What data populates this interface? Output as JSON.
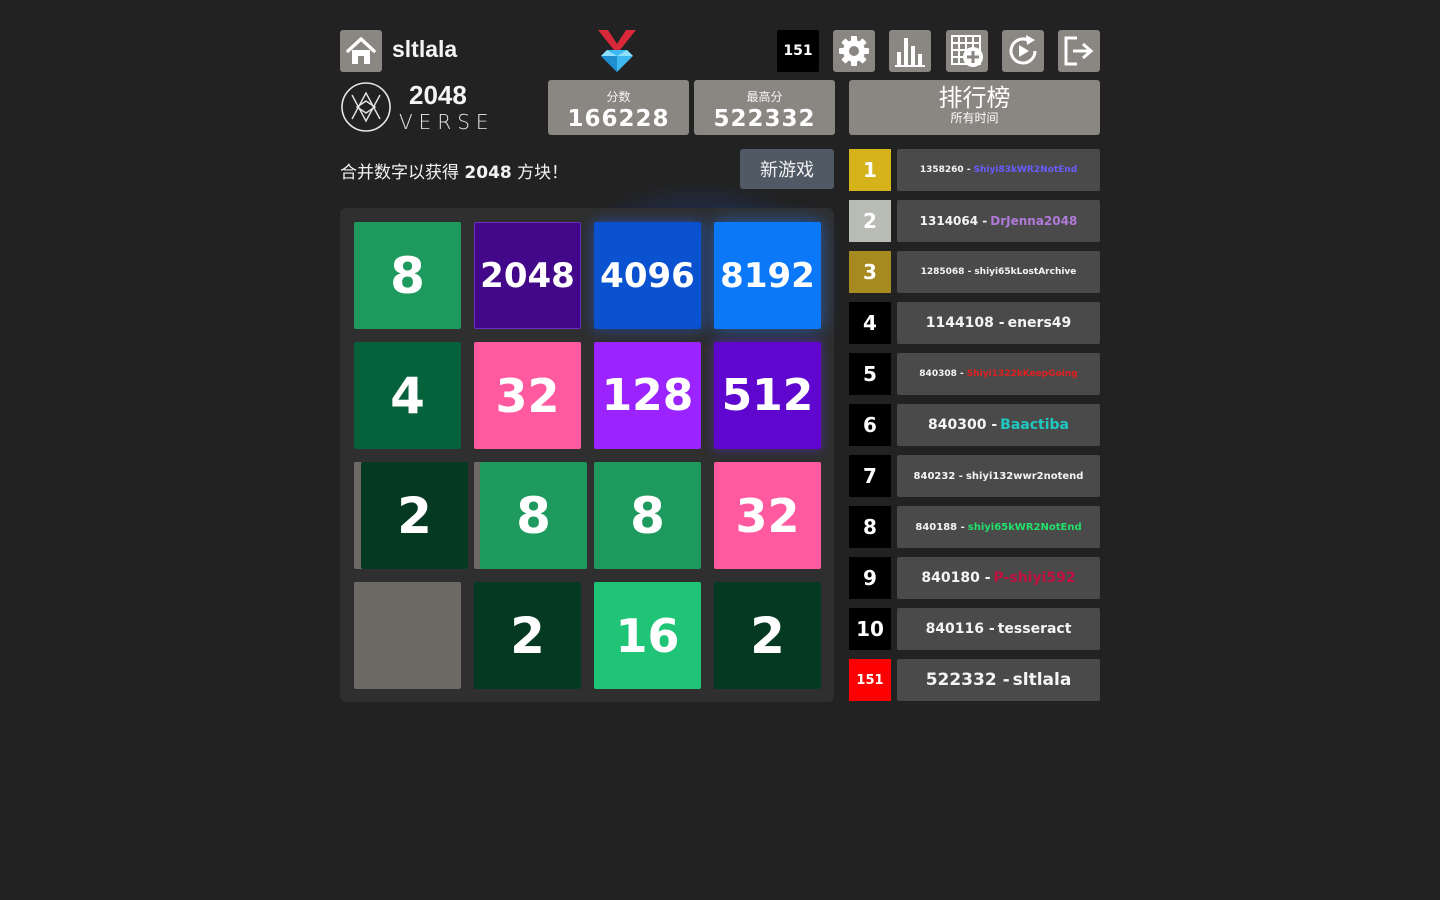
{
  "header": {
    "username": "sltlala",
    "rank_badge": "151",
    "toolbar": [
      "home-icon",
      "gem-medal-icon",
      "gear-icon",
      "bar-chart-icon",
      "grid-add-icon",
      "replay-icon",
      "logout-icon"
    ]
  },
  "logo": {
    "title": "2048",
    "subtitle": "VERSE"
  },
  "scores": {
    "score_label": "分数",
    "score_value": "166228",
    "best_label": "最高分",
    "best_value": "522332"
  },
  "leaderboard_header": {
    "title": "排行榜",
    "subtitle": "所有时间"
  },
  "tagline": {
    "prefix": "合并数字以获得 ",
    "highlight": "2048",
    "suffix": " 方块！"
  },
  "new_game_label": "新游戏",
  "board": [
    [
      "8",
      "2048",
      "4096",
      "8192"
    ],
    [
      "4",
      "32",
      "128",
      "512"
    ],
    [
      "2",
      "8",
      "8",
      "32"
    ],
    [
      "",
      "2",
      "16",
      "2"
    ]
  ],
  "leaderboard": [
    {
      "rank": "1",
      "score": "1358260 -",
      "name": "Shiyi83kWR2NotEnd",
      "rank_color": "#d6b21b",
      "name_color": "#6a5cff"
    },
    {
      "rank": "2",
      "score": "1314064 -",
      "name": "DrJenna2048",
      "rank_color": "#b8bcb4",
      "name_color": "#b07ad8"
    },
    {
      "rank": "3",
      "score": "1285068 -",
      "name": "shiyi65kLostArchive",
      "rank_color": "#a78a1f",
      "name_color": "#f4f4f4"
    },
    {
      "rank": "4",
      "score": "1144108 -",
      "name": "eners49",
      "rank_color": "#000000",
      "name_color": "#f4f4f4"
    },
    {
      "rank": "5",
      "score": "840308 -",
      "name": "Shiyi1322kKeepGoing",
      "rank_color": "#000000",
      "name_color": "#e02020"
    },
    {
      "rank": "6",
      "score": "840300 -",
      "name": "Baactiba",
      "rank_color": "#000000",
      "name_color": "#1fc7c0"
    },
    {
      "rank": "7",
      "score": "840232 -",
      "name": "shiyi132wwr2notend",
      "rank_color": "#000000",
      "name_color": "#f4f4f4"
    },
    {
      "rank": "8",
      "score": "840188 -",
      "name": "shiyi65kWR2NotEnd",
      "rank_color": "#000000",
      "name_color": "#22e06a"
    },
    {
      "rank": "9",
      "score": "840180 -",
      "name": "P-shiyi592",
      "rank_color": "#000000",
      "name_color": "#c01040"
    },
    {
      "rank": "10",
      "score": "840116 -",
      "name": "tesseract",
      "rank_color": "#000000",
      "name_color": "#f4f4f4"
    },
    {
      "rank": "151",
      "score": "522332 -",
      "name": "sltlala",
      "rank_color": "#ff0000",
      "name_color": "#f4f4f4"
    }
  ],
  "colors": {
    "background": "#222222",
    "button": "#8a8682",
    "board": "#2f2f2f",
    "new_game": "#505a65"
  }
}
